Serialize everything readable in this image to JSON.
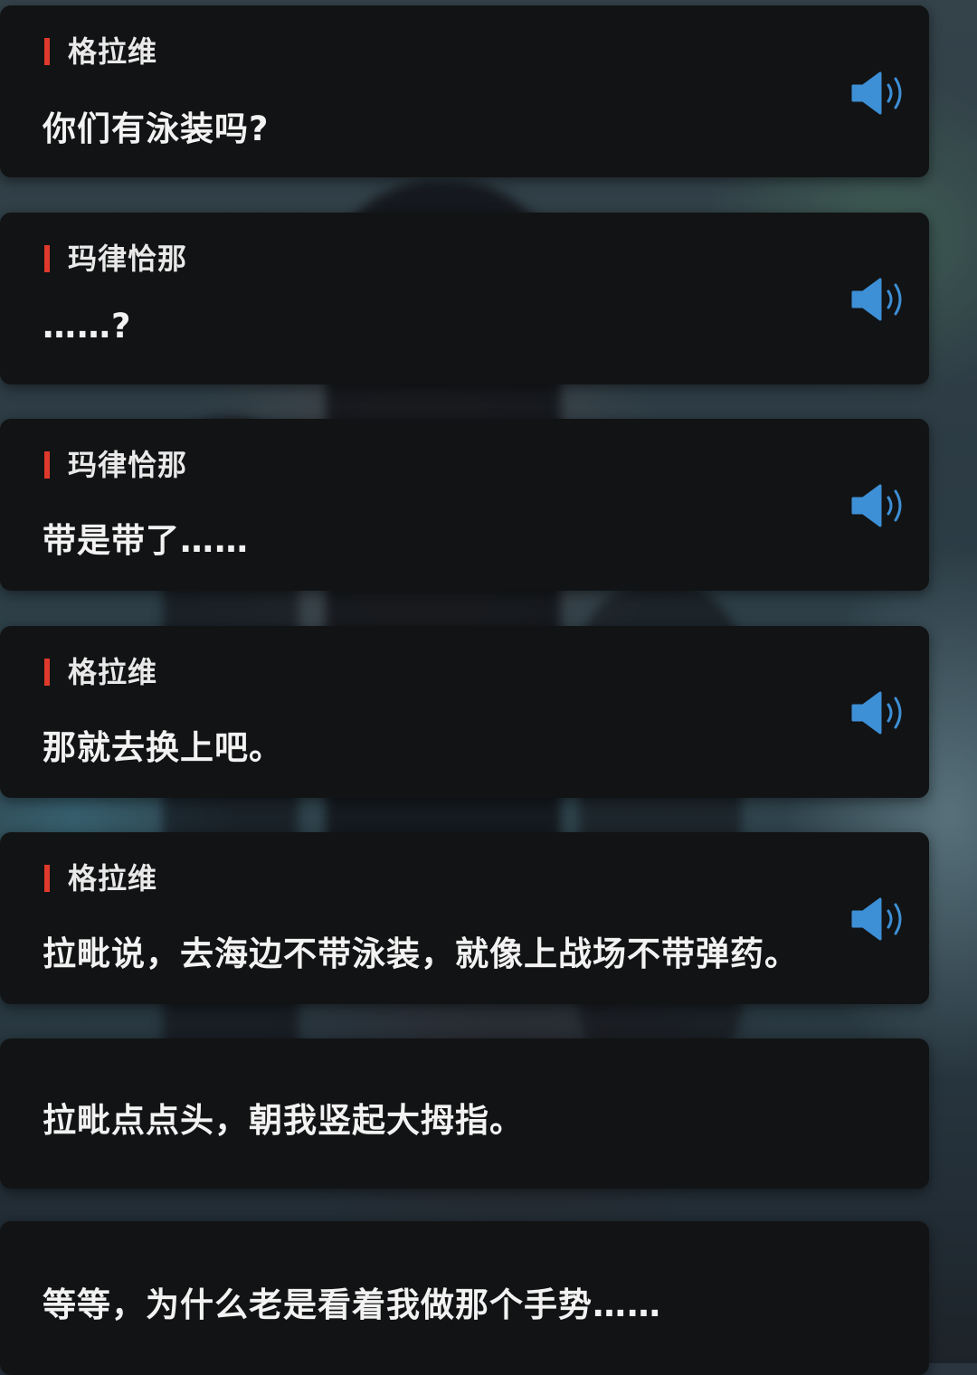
{
  "dialogue": [
    {
      "speaker": "格拉维",
      "text": "你们有泳装吗?",
      "voice_icon": "speaker-volume-icon"
    },
    {
      "speaker": "玛律恰那",
      "text": "……?",
      "voice_icon": "speaker-volume-icon"
    },
    {
      "speaker": "玛律恰那",
      "text": "带是带了……",
      "voice_icon": "speaker-volume-icon"
    },
    {
      "speaker": "格拉维",
      "text": "那就去换上吧。",
      "voice_icon": "speaker-volume-icon"
    },
    {
      "speaker": "格拉维",
      "text": "拉毗说，去海边不带泳装，就像上战场不带弹药。",
      "voice_icon": "speaker-volume-icon"
    }
  ],
  "narration": [
    {
      "text": "拉毗点点头，朝我竖起大拇指。"
    },
    {
      "text": "等等，为什么老是看着我做那个手势……"
    }
  ],
  "colors": {
    "card_background": "#121314",
    "speaker_accent": "#e0392b",
    "voice_icon": "#3d8fd6",
    "text": "#f2f2f2"
  }
}
